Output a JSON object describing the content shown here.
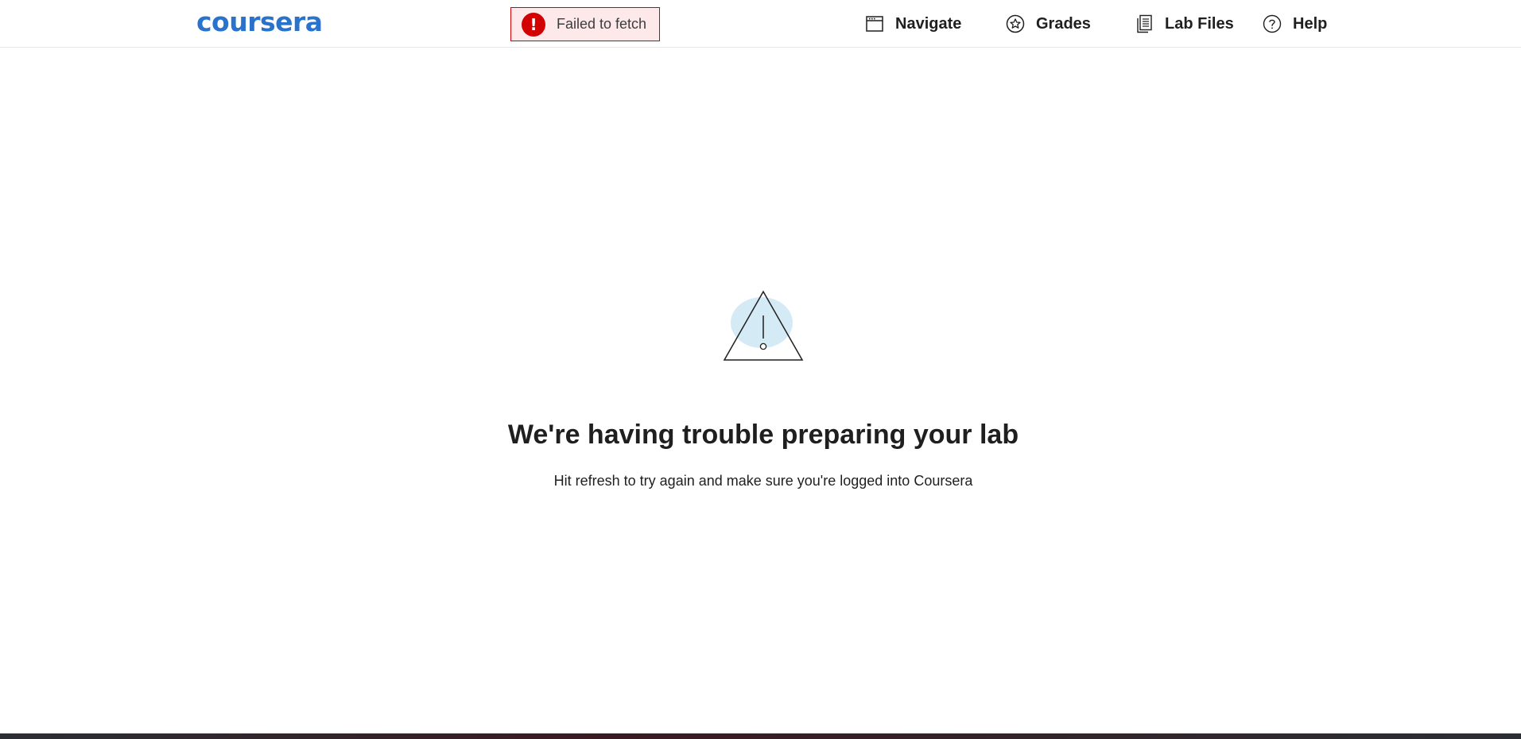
{
  "header": {
    "logo": "coursera",
    "error_toast": {
      "icon": "exclamation-icon",
      "symbol": "!",
      "text": "Failed to fetch"
    },
    "nav": {
      "navigate": {
        "label": "Navigate",
        "icon": "navigate-window-icon"
      },
      "grades": {
        "label": "Grades",
        "icon": "star-badge-icon"
      },
      "lab_files": {
        "label": "Lab Files",
        "icon": "documents-icon"
      },
      "help": {
        "label": "Help",
        "icon": "question-circle-icon"
      }
    }
  },
  "main": {
    "graphic": "warning-triangle-icon",
    "title": "We're having trouble preparing your lab",
    "subtitle": "Hit refresh to try again and make sure you're logged into Coursera"
  },
  "colors": {
    "brand": "#2a73cc",
    "error": "#d30001",
    "error_bg": "#fde8ea",
    "illustration_blob": "#d4eaf5"
  }
}
